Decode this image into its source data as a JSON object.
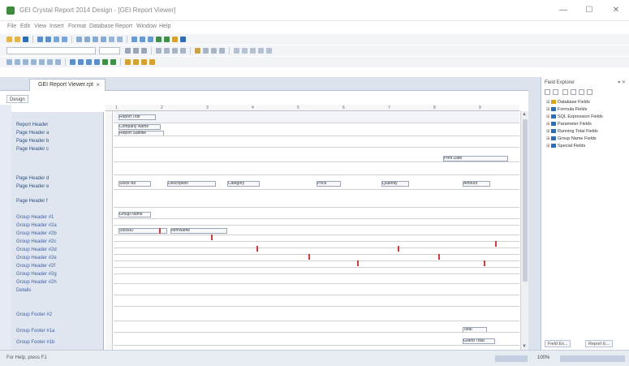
{
  "app": {
    "title": "GEI Crystal Report 2014 Design - [GEI Report Viewer]",
    "accent_color": "#2f6db5"
  },
  "window_controls": {
    "minimize": "—",
    "maximize": "☐",
    "close": "✕"
  },
  "menu": [
    "File",
    "Edit",
    "View",
    "Insert",
    "Format",
    "Database",
    "Report",
    "Window",
    "Help"
  ],
  "tabs": {
    "document": "GEI Report Viewer.rpt",
    "close": "×",
    "design": "Design"
  },
  "bands": [
    "Report Header",
    "Page Header a",
    "Page Header b",
    "Page Header c",
    "Page Header d",
    "Page Header e",
    "Page Header f",
    "Group Header #1",
    "Group Header #2a",
    "Group Header #2b",
    "Group Header #2c",
    "Group Header #2d",
    "Group Header #2e",
    "Group Header #2f",
    "Group Header #2g",
    "Group Header #2h",
    "Details",
    "Group Footer #2",
    "Group Footer #1a",
    "Group Footer #1b"
  ],
  "ruler": [
    "1",
    "2",
    "3",
    "4",
    "5",
    "6",
    "7",
    "8",
    "9"
  ],
  "canvas_fields": {
    "report_title": "Report Title",
    "company_name": "Company Name",
    "report_subtitle": "Report Subtitle",
    "print_date": "Print Date",
    "column_1": "Stock No",
    "column_2": "Description",
    "column_3": "Category",
    "column_4": "Price",
    "column_5": "Quantity",
    "column_6": "Amount",
    "group_name": "Group Name",
    "detail_1": "StockID",
    "detail_2": "ItemName",
    "total_label": "Total",
    "grand_total": "Grand Total"
  },
  "field_explorer": {
    "title": "Field Explorer",
    "pin": "▾ ✕",
    "items": [
      {
        "label": "Database Fields",
        "color": "#d9a21b"
      },
      {
        "label": "Formula Fields",
        "color": "#2f6db5"
      },
      {
        "label": "SQL Expression Fields",
        "color": "#2f6db5"
      },
      {
        "label": "Parameter Fields",
        "color": "#2f6db5"
      },
      {
        "label": "Running Total Fields",
        "color": "#2f6db5"
      },
      {
        "label": "Group Name Fields",
        "color": "#2f6db5"
      },
      {
        "label": "Special Fields",
        "color": "#2f6db5"
      }
    ],
    "bottom_tabs": [
      "Field Ex...",
      "Report E..."
    ]
  },
  "status": {
    "text": "For Help, press F1",
    "zoom": "100%"
  }
}
